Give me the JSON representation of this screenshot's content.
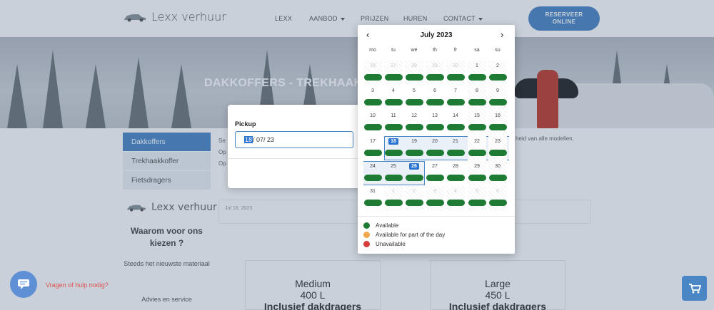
{
  "header": {
    "logo_text": "Lexx verhuur",
    "nav": [
      "LEXX",
      "AANBOD",
      "PRIJZEN",
      "HUREN",
      "CONTACT"
    ],
    "reserve_label_1": "RESERVEER",
    "reserve_label_2": "ONLINE"
  },
  "hero": {
    "title": "DAKKOFFERS - TREKHAAK"
  },
  "sidebar": {
    "items": [
      "Dakkoffers",
      "Trekhaakkoffer",
      "Fietsdragers"
    ],
    "logo_text": "Lexx verhuur",
    "why_title": "Waarom voor ons kiezen ?",
    "perks": [
      "Steeds het nieuwste materiaal",
      "Advies en service"
    ]
  },
  "content": {
    "line1": "Se",
    "line2": "Op",
    "line3": "Op",
    "right_text": "heid van alle modellen.",
    "post_date": "Jul 18, 2023"
  },
  "cards": [
    {
      "name": "Medium",
      "size": "400 L",
      "extra": "Inclusief dakdragers"
    },
    {
      "name": "Large",
      "size": "450 L",
      "extra": "Inclusief dakdragers"
    }
  ],
  "pickup": {
    "label": "Pickup",
    "value_sel": "18",
    "value_rest": "/ 07/ 23"
  },
  "calendar": {
    "month": "July 2023",
    "prev": "‹",
    "next": "›",
    "dow": [
      "mo",
      "tu",
      "we",
      "th",
      "fr",
      "sa",
      "su"
    ],
    "weeks": [
      [
        "26",
        "27",
        "28",
        "29",
        "30",
        "1",
        "2"
      ],
      [
        "3",
        "4",
        "5",
        "6",
        "7",
        "8",
        "9"
      ],
      [
        "10",
        "11",
        "12",
        "13",
        "14",
        "15",
        "16"
      ],
      [
        "17",
        "18",
        "19",
        "20",
        "21",
        "22",
        "23"
      ],
      [
        "24",
        "25",
        "26",
        "27",
        "28",
        "29",
        "30"
      ],
      [
        "31",
        "1",
        "2",
        "3",
        "4",
        "5",
        "6"
      ]
    ],
    "selected_start": "18",
    "selected_end": "26",
    "legend": [
      {
        "label": "Available",
        "color": "#1e7b34"
      },
      {
        "label": "Available for part of the day",
        "color": "#f0a84a"
      },
      {
        "label": "Unavailable",
        "color": "#d63b3b"
      }
    ]
  },
  "chat": {
    "text": "Vragen of hulp nodig?"
  }
}
